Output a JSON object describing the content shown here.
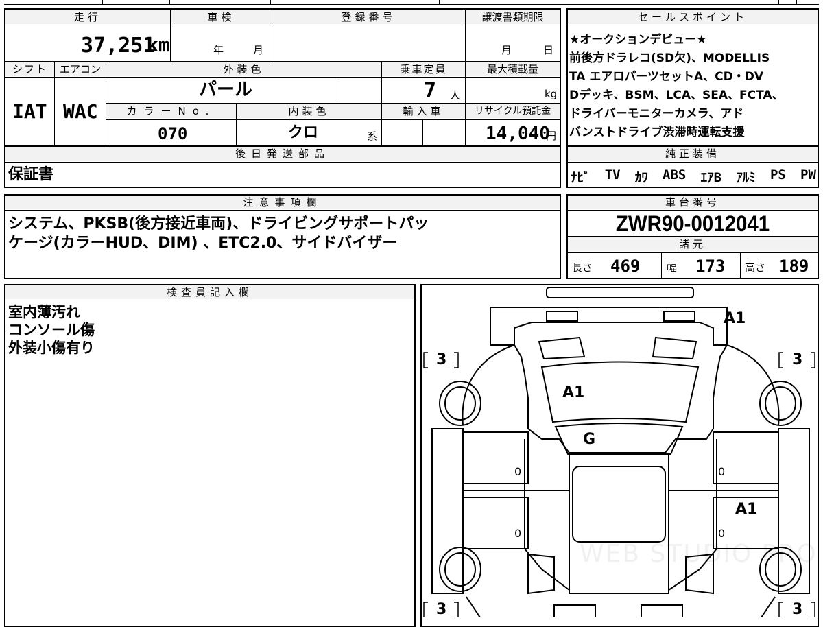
{
  "top_fragment": "",
  "headers": {
    "mileage": "走行",
    "inspection": "車検",
    "registration_no": "登録番号",
    "transfer_deadline": "譲渡書類期限",
    "sales_point": "セールスポイント",
    "shift": "シフト",
    "aircon": "エアコン",
    "exterior_color": "外装色",
    "capacity": "乗車定員",
    "max_load": "最大積載量",
    "color_no": "カラーNo.",
    "interior_color": "内装色",
    "import": "輸入車",
    "recycle_fee": "リサイクル預託金",
    "later_parts": "後日発送部品",
    "genuine_equipment": "純正装備",
    "notes": "注意事項欄",
    "chassis_no": "車台番号",
    "specs": "諸元",
    "inspector": "検査員記入欄"
  },
  "values": {
    "mileage": "37,251",
    "mileage_unit": "km",
    "year_unit": "年",
    "month_unit": "月",
    "deadline_month": "月",
    "deadline_day": "日",
    "shift": "IAT",
    "aircon": "WAC",
    "exterior_color": "パール",
    "capacity": "7",
    "capacity_unit": "人",
    "load_unit": "kg",
    "color_no": "070",
    "interior_color": "クロ",
    "interior_suffix": "系",
    "recycle_fee": "14,040",
    "yen_unit": "円",
    "later_parts": "保証書",
    "chassis_no": "ZWR90-0012041"
  },
  "sales_point_lines": [
    "★オークションデビュー★",
    "前後方ドラレコ(SD欠)、MODELLIS",
    "TA エアロパーツセットA、CD・DV",
    "Dデッキ、BSM、LCA、SEA、FCTA、",
    "ドライバーモニターカメラ、アド",
    "バンストドライブ渋滞時運転支援"
  ],
  "equipment": [
    "ﾅﾋﾞ",
    "TV",
    "ｶﾜ",
    "ABS",
    "ｴｱB",
    "ｱﾙﾐ",
    "PS",
    "PW"
  ],
  "notes_lines": [
    "システム、PKSB(後方接近車両)、ドライビングサポートパッ",
    "ケージ(カラーHUD、DIM) 、ETC2.0、サイドバイザー"
  ],
  "specs": {
    "length_label": "長さ",
    "length": "469",
    "width_label": "幅",
    "width": "173",
    "height_label": "高さ",
    "height": "189"
  },
  "inspector_lines": [
    "室内薄汚れ",
    "コンソール傷",
    "外装小傷有り"
  ],
  "diagram": {
    "grades": {
      "tl": "3",
      "tr": "3",
      "bl": "3",
      "br": "3"
    },
    "marks": {
      "rear": "A1",
      "roof": "A1",
      "glass": "G",
      "side": "A1"
    },
    "doors": {
      "lf": "0",
      "rf": "0",
      "lr": "0",
      "rr": "0"
    },
    "watermark": "WEB STUDIO PRO"
  }
}
